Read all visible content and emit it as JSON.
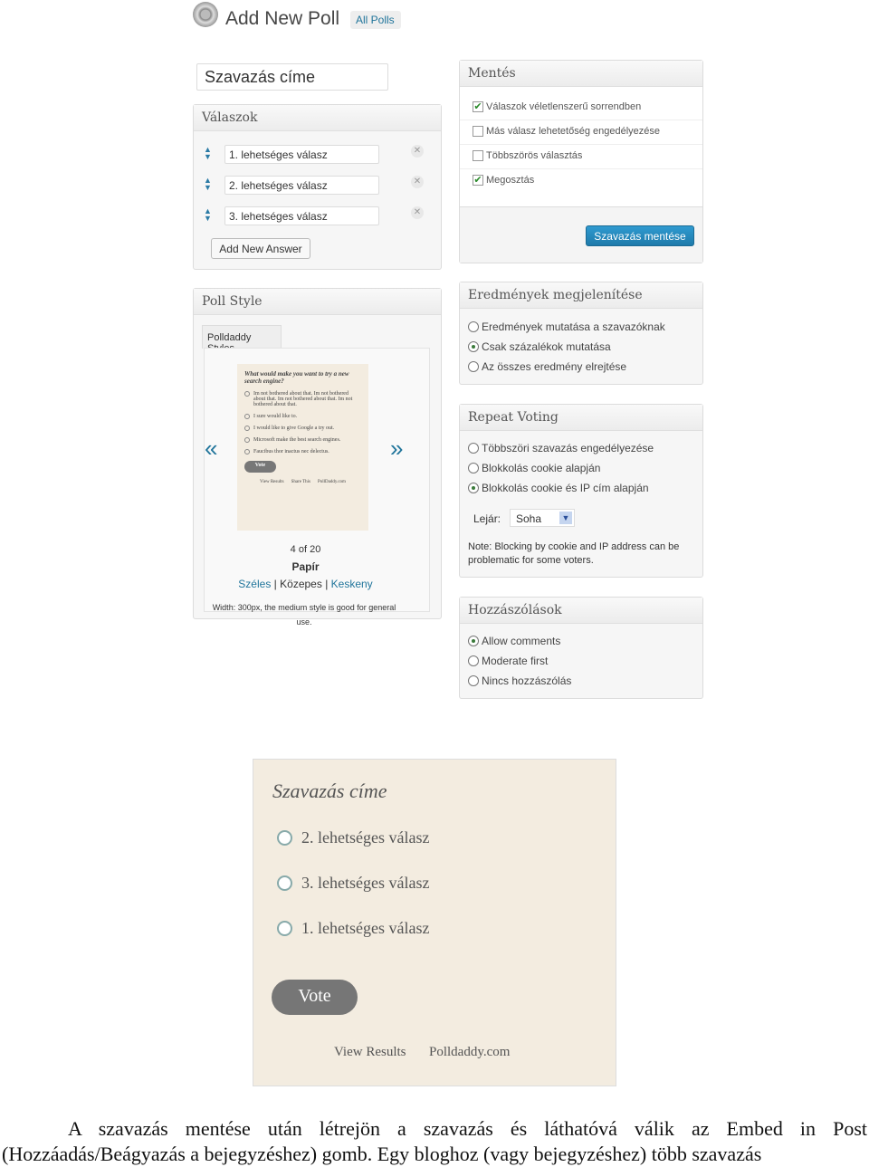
{
  "header": {
    "title": "Add New Poll",
    "all_polls": "All Polls",
    "icon": "poll-icon"
  },
  "title_input": "Szavazás címe",
  "answers": {
    "heading": "Válaszok",
    "items": [
      "1. lehetséges válasz",
      "2. lehetséges válasz",
      "3. lehetséges válasz"
    ],
    "add_label": "Add New Answer"
  },
  "save": {
    "heading": "Mentés",
    "options": [
      {
        "label": "Válaszok véletlenszerű sorrendben",
        "checked": true
      },
      {
        "label": "Más válasz lehetetőség engedélyezése",
        "checked": false
      },
      {
        "label": "Többszörös választás",
        "checked": false
      },
      {
        "label": "Megosztás",
        "checked": true
      }
    ],
    "button": "Szavazás mentése",
    "accent": "#2389b9"
  },
  "poll_style": {
    "heading": "Poll Style",
    "tab": "Polldaddy Styles",
    "preview": {
      "question": "What would make you want to try a new search engine?",
      "options": [
        "Im not bothered about that. Im not bothered about that. Im not bothered about that. Im not bothered about that.",
        "I sure would like to.",
        "I would like to give Google a try out.",
        "Microsoft make the best search engines.",
        "Faucibus thor inactus nec delectus."
      ],
      "vote": "Vote",
      "links": [
        "View Results",
        "Share This",
        "PollDaddy.com"
      ]
    },
    "counter": "4 of 20",
    "style_name": "Papír",
    "sizes": [
      "Széles",
      "Közepes",
      "Keskeny"
    ],
    "separator": "|",
    "description": "Width: 300px, the medium style is good for general use."
  },
  "results": {
    "heading": "Eredmények megjelenítése",
    "options": [
      {
        "label": "Eredmények mutatása a szavazóknak",
        "selected": false
      },
      {
        "label": "Csak százalékok mutatása",
        "selected": true
      },
      {
        "label": "Az összes eredmény elrejtése",
        "selected": false
      }
    ]
  },
  "repeat": {
    "heading": "Repeat Voting",
    "options": [
      {
        "label": "Többszöri szavazás engedélyezése",
        "selected": false
      },
      {
        "label": "Blokkolás cookie alapján",
        "selected": false
      },
      {
        "label": "Blokkolás cookie és IP cím alapján",
        "selected": true
      }
    ],
    "expire_label": "Lejár:",
    "expire_value": "Soha",
    "note": "Note: Blocking by cookie and IP address can be problematic for some voters."
  },
  "comments": {
    "heading": "Hozzászólások",
    "options": [
      {
        "label": "Allow comments",
        "selected": true
      },
      {
        "label": "Moderate first",
        "selected": false
      },
      {
        "label": "Nincs hozzászólás",
        "selected": false
      }
    ]
  },
  "big_preview": {
    "title": "Szavazás címe",
    "options": [
      "2. lehetséges válasz",
      "3. lehetséges válasz",
      "1. lehetséges válasz"
    ],
    "vote": "Vote",
    "links": [
      "View Results",
      "Polldaddy.com"
    ],
    "bg": "#f3ece0"
  },
  "paragraph": "A szavazás mentése után létrejön a szavazás és láthatóvá válik az Embed in Post (Hozzáadás/Beágyazás a bejegyzéshez) gomb. Egy bloghoz (vagy bejegyzéshez) több szavazás"
}
